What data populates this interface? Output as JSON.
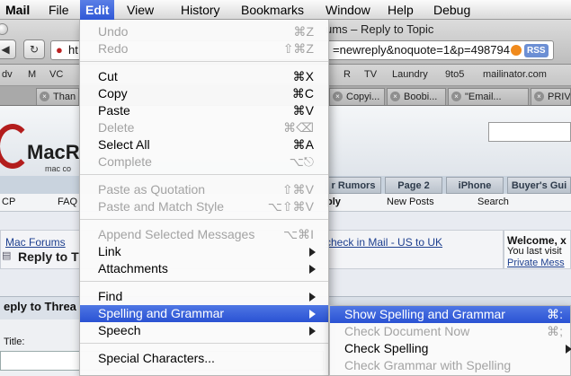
{
  "menubar": {
    "items": [
      "Mail",
      "File",
      "Edit",
      "View",
      "History",
      "Bookmarks",
      "Window",
      "Help",
      "Debug"
    ],
    "active_index": 2
  },
  "browser": {
    "window_title": "ums – Reply to Topic",
    "url_left": "ht",
    "url_right": "=newreply&noquote=1&p=498794",
    "rss": "RSS",
    "bookmarks": [
      "dv",
      "M",
      "VC",
      "R",
      "TV",
      "Laundry",
      "9to5",
      "mailinator.com"
    ],
    "tabs": [
      "Than",
      "Copyi...",
      "Boobi...",
      "\"Email...",
      "PRIV"
    ]
  },
  "page": {
    "logo_text": "MacR",
    "logo_sub": "mac co",
    "nav_tabs": [
      "r Rumors",
      "Page 2",
      "iPhone",
      "Buyer's Gui"
    ],
    "subnav": [
      "CP",
      "FAQ",
      "ply",
      "New Posts",
      "Search"
    ],
    "breadcrumb": "Mac Forums",
    "breadcrumb_sep": ">",
    "thread_title": "Reply to T",
    "breadcrumb_right": "check in Mail - US to UK",
    "welcome_title": "Welcome, x",
    "welcome_line": "You last visit",
    "welcome_link": "Private Mess",
    "reply_heading": "eply to Threa",
    "form_label": "Title:"
  },
  "edit_menu": {
    "undo": "Undo",
    "undo_sc": "⌘Z",
    "redo": "Redo",
    "redo_sc": "⇧⌘Z",
    "cut": "Cut",
    "cut_sc": "⌘X",
    "copy": "Copy",
    "copy_sc": "⌘C",
    "paste": "Paste",
    "paste_sc": "⌘V",
    "delete": "Delete",
    "delete_sc": "⌘⌫",
    "select_all": "Select All",
    "select_all_sc": "⌘A",
    "complete": "Complete",
    "complete_sc": "⌥⎋",
    "paste_quotation": "Paste as Quotation",
    "paste_quotation_sc": "⇧⌘V",
    "paste_match": "Paste and Match Style",
    "paste_match_sc": "⌥⇧⌘V",
    "append": "Append Selected Messages",
    "append_sc": "⌥⌘I",
    "link": "Link",
    "attachments": "Attachments",
    "find": "Find",
    "spelling": "Spelling and Grammar",
    "speech": "Speech",
    "special": "Special Characters..."
  },
  "spelling_menu": {
    "show": "Show Spelling and Grammar",
    "show_sc": "⌘:",
    "check_now": "Check Document Now",
    "check_now_sc": "⌘;",
    "check_spelling": "Check Spelling",
    "check_grammar": "Check Grammar with Spelling"
  }
}
